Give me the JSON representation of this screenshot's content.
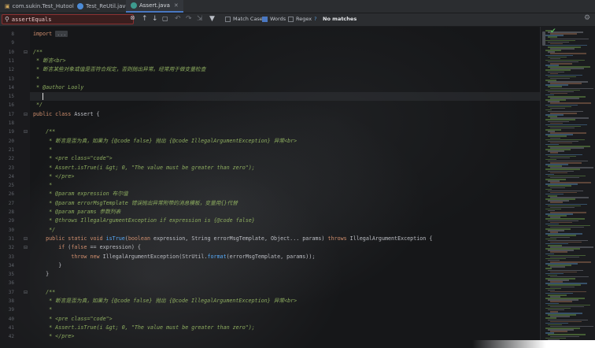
{
  "tabs": [
    {
      "label": "com.sukin.Test_Hutool",
      "active": false
    },
    {
      "label": "Test_ReUtil.java",
      "active": false
    },
    {
      "label": "Assert.java",
      "active": true
    }
  ],
  "find": {
    "query": "assertEquals",
    "options": [
      {
        "label": "Match Case",
        "checked": false
      },
      {
        "label": "Words",
        "checked": true
      },
      {
        "label": "Regex",
        "checked": false
      }
    ],
    "regex_help": "?",
    "status": "No matches"
  },
  "editor": {
    "lines": [
      {
        "n": "8",
        "html": "<span class=\"kw\">import</span> <span class=\"fold-box\">...</span>"
      },
      {
        "n": "9",
        "html": ""
      },
      {
        "n": "10",
        "html": "<span class=\"cm\">/**</span>"
      },
      {
        "n": "11",
        "html": "<span class=\"cm\"> * 断言&lt;br&gt;</span>"
      },
      {
        "n": "12",
        "html": "<span class=\"cm\"> * 断言某些对象或值是否符合规定，否则抛出异常。经常用于做变量检查</span>"
      },
      {
        "n": "13",
        "html": "<span class=\"cm\"> *</span>"
      },
      {
        "n": "14",
        "html": "<span class=\"cm\"> * @author Looly</span>"
      },
      {
        "n": "15",
        "html": "",
        "caret": true
      },
      {
        "n": "16",
        "html": "<span class=\"cm\"> */</span>"
      },
      {
        "n": "17",
        "html": "<span class=\"kw\">public class</span> Assert {"
      },
      {
        "n": "18",
        "html": ""
      },
      {
        "n": "19",
        "html": "    <span class=\"cm\">/**</span>"
      },
      {
        "n": "20",
        "html": "<span class=\"cm\">     * 断言是否为真，如果为 {@code false} 抛出 {@code IllegalArgumentException} 异常&lt;br&gt;</span>"
      },
      {
        "n": "21",
        "html": "<span class=\"cm\">     *</span>"
      },
      {
        "n": "22",
        "html": "<span class=\"cm\">     * &lt;pre class=\"code\"&gt;</span>"
      },
      {
        "n": "23",
        "html": "<span class=\"cm\">     * Assert.isTrue(i &amp;gt; 0, \"The value must be greater than zero\");</span>"
      },
      {
        "n": "24",
        "html": "<span class=\"cm\">     * &lt;/pre&gt;</span>"
      },
      {
        "n": "25",
        "html": "<span class=\"cm\">     *</span>"
      },
      {
        "n": "26",
        "html": "<span class=\"cm\">     * @param expression 布尔值</span>"
      },
      {
        "n": "27",
        "html": "<span class=\"cm\">     * @param errorMsgTemplate 错误抛出异常附带的消息模板，变量用{}代替</span>"
      },
      {
        "n": "28",
        "html": "<span class=\"cm\">     * @param params 参数列表</span>"
      },
      {
        "n": "29",
        "html": "<span class=\"cm\">     * @throws IllegalArgumentException if expression is {@code false}</span>"
      },
      {
        "n": "30",
        "html": "<span class=\"cm\">     */</span>"
      },
      {
        "n": "31",
        "html": "    <span class=\"kw\">public static void</span> <span class=\"fn\">isTrue</span>(<span class=\"kw\">boolean</span> expression, String errorMsgTemplate, Object... params) <span class=\"kw\">throws</span> IllegalArgumentException {"
      },
      {
        "n": "32",
        "html": "        <span class=\"kw\">if</span> (<span class=\"kw\">false</span> == expression) {"
      },
      {
        "n": "33",
        "html": "            <span class=\"kw\">throw new</span> IllegalArgumentException(StrUtil.<span class=\"fn\">format</span>(errorMsgTemplate, params));"
      },
      {
        "n": "34",
        "html": "        }"
      },
      {
        "n": "35",
        "html": "    }"
      },
      {
        "n": "36",
        "html": ""
      },
      {
        "n": "37",
        "html": "    <span class=\"cm\">/**</span>"
      },
      {
        "n": "38",
        "html": "<span class=\"cm\">     * 断言是否为真，如果为 {@code false} 抛出 {@code IllegalArgumentException} 异常&lt;br&gt;</span>"
      },
      {
        "n": "39",
        "html": "<span class=\"cm\">     *</span>"
      },
      {
        "n": "40",
        "html": "<span class=\"cm\">     * &lt;pre class=\"code\"&gt;</span>"
      },
      {
        "n": "41",
        "html": "<span class=\"cm\">     * Assert.isTrue(i &amp;gt; 0, \"The value must be greater than zero\");</span>"
      },
      {
        "n": "42",
        "html": "<span class=\"cm\">     * &lt;/pre&gt;</span>"
      }
    ]
  },
  "colors": {
    "accent": "#4a78c2",
    "comment": "#8dac5f",
    "keyword": "#cf8e6d",
    "error_border": "#8a3030"
  }
}
